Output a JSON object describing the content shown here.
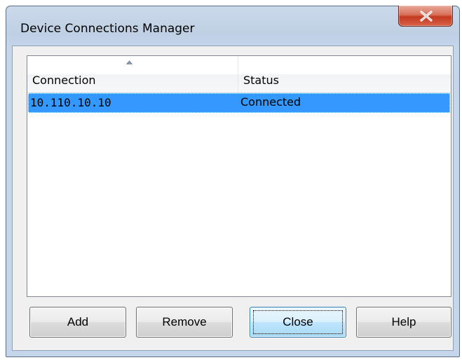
{
  "window": {
    "title": "Device Connections Manager"
  },
  "titlebar": {
    "close_icon": "close-x-icon"
  },
  "listview": {
    "columns": [
      {
        "label": "Connection",
        "sorted": "ascending"
      },
      {
        "label": "Status"
      }
    ],
    "rows": [
      {
        "connection": "10.110.10.10",
        "status": "Connected",
        "selected": true
      }
    ]
  },
  "buttons": {
    "add_label": "Add",
    "remove_label": "Remove",
    "close_label": "Close",
    "help_label": "Help"
  },
  "colors": {
    "selection": "#3399ff",
    "close_button": "#c4391e"
  }
}
